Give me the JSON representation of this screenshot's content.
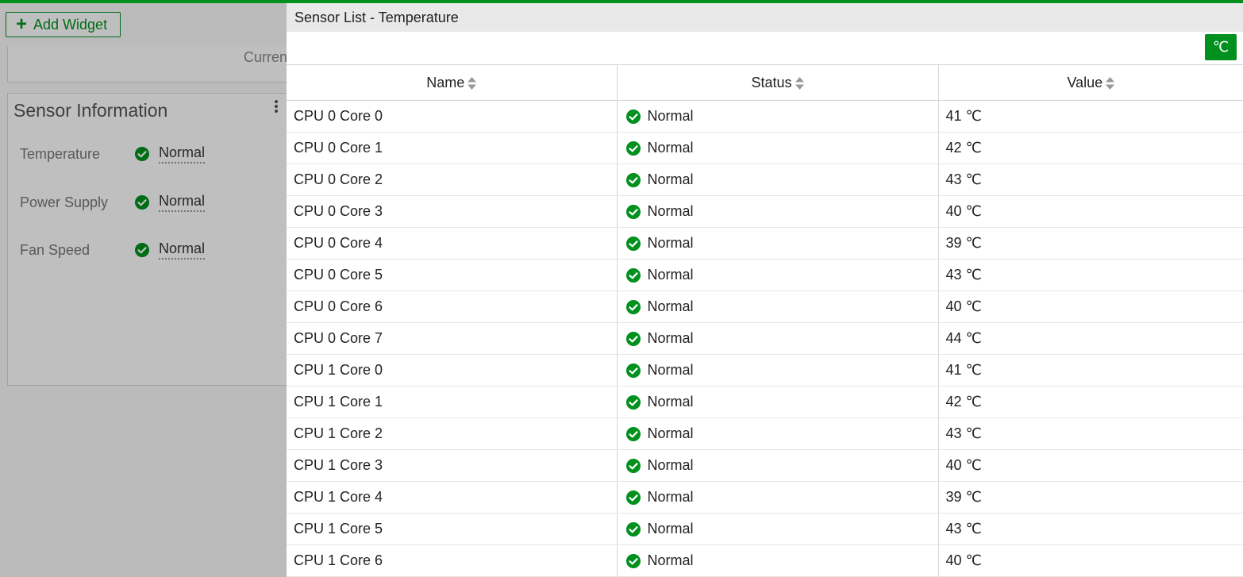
{
  "dashboard": {
    "add_widget_label": "Add Widget",
    "current_label": "Curren",
    "sensor_widget": {
      "title": "Sensor Information",
      "rows": [
        {
          "label": "Temperature",
          "status": "Normal"
        },
        {
          "label": "Power Supply",
          "status": "Normal"
        },
        {
          "label": "Fan Speed",
          "status": "Normal"
        }
      ]
    }
  },
  "panel": {
    "title": "Sensor List - Temperature",
    "unit_toggle": "℃",
    "columns": [
      "Name",
      "Status",
      "Value"
    ],
    "rows": [
      {
        "name": "CPU 0 Core 0",
        "status": "Normal",
        "value": "41 ℃"
      },
      {
        "name": "CPU 0 Core 1",
        "status": "Normal",
        "value": "42 ℃"
      },
      {
        "name": "CPU 0 Core 2",
        "status": "Normal",
        "value": "43 ℃"
      },
      {
        "name": "CPU 0 Core 3",
        "status": "Normal",
        "value": "40 ℃"
      },
      {
        "name": "CPU 0 Core 4",
        "status": "Normal",
        "value": "39 ℃"
      },
      {
        "name": "CPU 0 Core 5",
        "status": "Normal",
        "value": "43 ℃"
      },
      {
        "name": "CPU 0 Core 6",
        "status": "Normal",
        "value": "40 ℃"
      },
      {
        "name": "CPU 0 Core 7",
        "status": "Normal",
        "value": "44 ℃"
      },
      {
        "name": "CPU 1 Core 0",
        "status": "Normal",
        "value": "41 ℃"
      },
      {
        "name": "CPU 1 Core 1",
        "status": "Normal",
        "value": "42 ℃"
      },
      {
        "name": "CPU 1 Core 2",
        "status": "Normal",
        "value": "43 ℃"
      },
      {
        "name": "CPU 1 Core 3",
        "status": "Normal",
        "value": "40 ℃"
      },
      {
        "name": "CPU 1 Core 4",
        "status": "Normal",
        "value": "39 ℃"
      },
      {
        "name": "CPU 1 Core 5",
        "status": "Normal",
        "value": "43 ℃"
      },
      {
        "name": "CPU 1 Core 6",
        "status": "Normal",
        "value": "40 ℃"
      }
    ]
  },
  "colors": {
    "accent": "#00901e",
    "status_ok": "#00901e"
  },
  "icons": {
    "add": "plus-icon",
    "status": "check-circle-icon",
    "sort": "sort-icon",
    "menu": "kebab-icon"
  }
}
